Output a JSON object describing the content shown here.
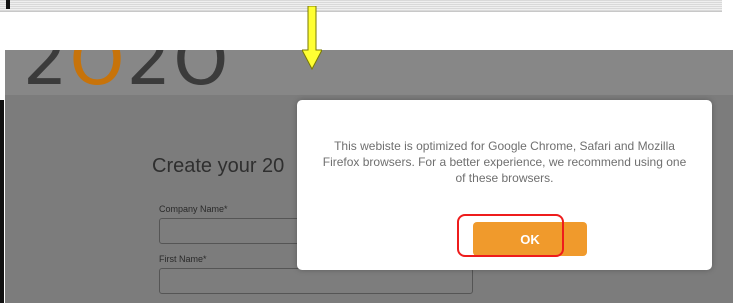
{
  "brand": {
    "logo_prefix": "2",
    "logo_o": "O",
    "logo_suffix": "2O"
  },
  "form": {
    "title": "Create your 20",
    "fields": [
      {
        "label": "Company Name*"
      },
      {
        "label": "First Name*"
      }
    ]
  },
  "modal": {
    "message": "This webiste is optimized for Google Chrome, Safari and Mozilla Firefox browsers. For a better experience, we recommend using one of these browsers.",
    "ok_label": "OK"
  },
  "colors": {
    "button": "#f09a2c",
    "highlight": "#ee1c1c",
    "arrow": "#ffff33",
    "logo_accent": "#c7730a"
  },
  "icons": {
    "arrow": "down-arrow-icon"
  }
}
